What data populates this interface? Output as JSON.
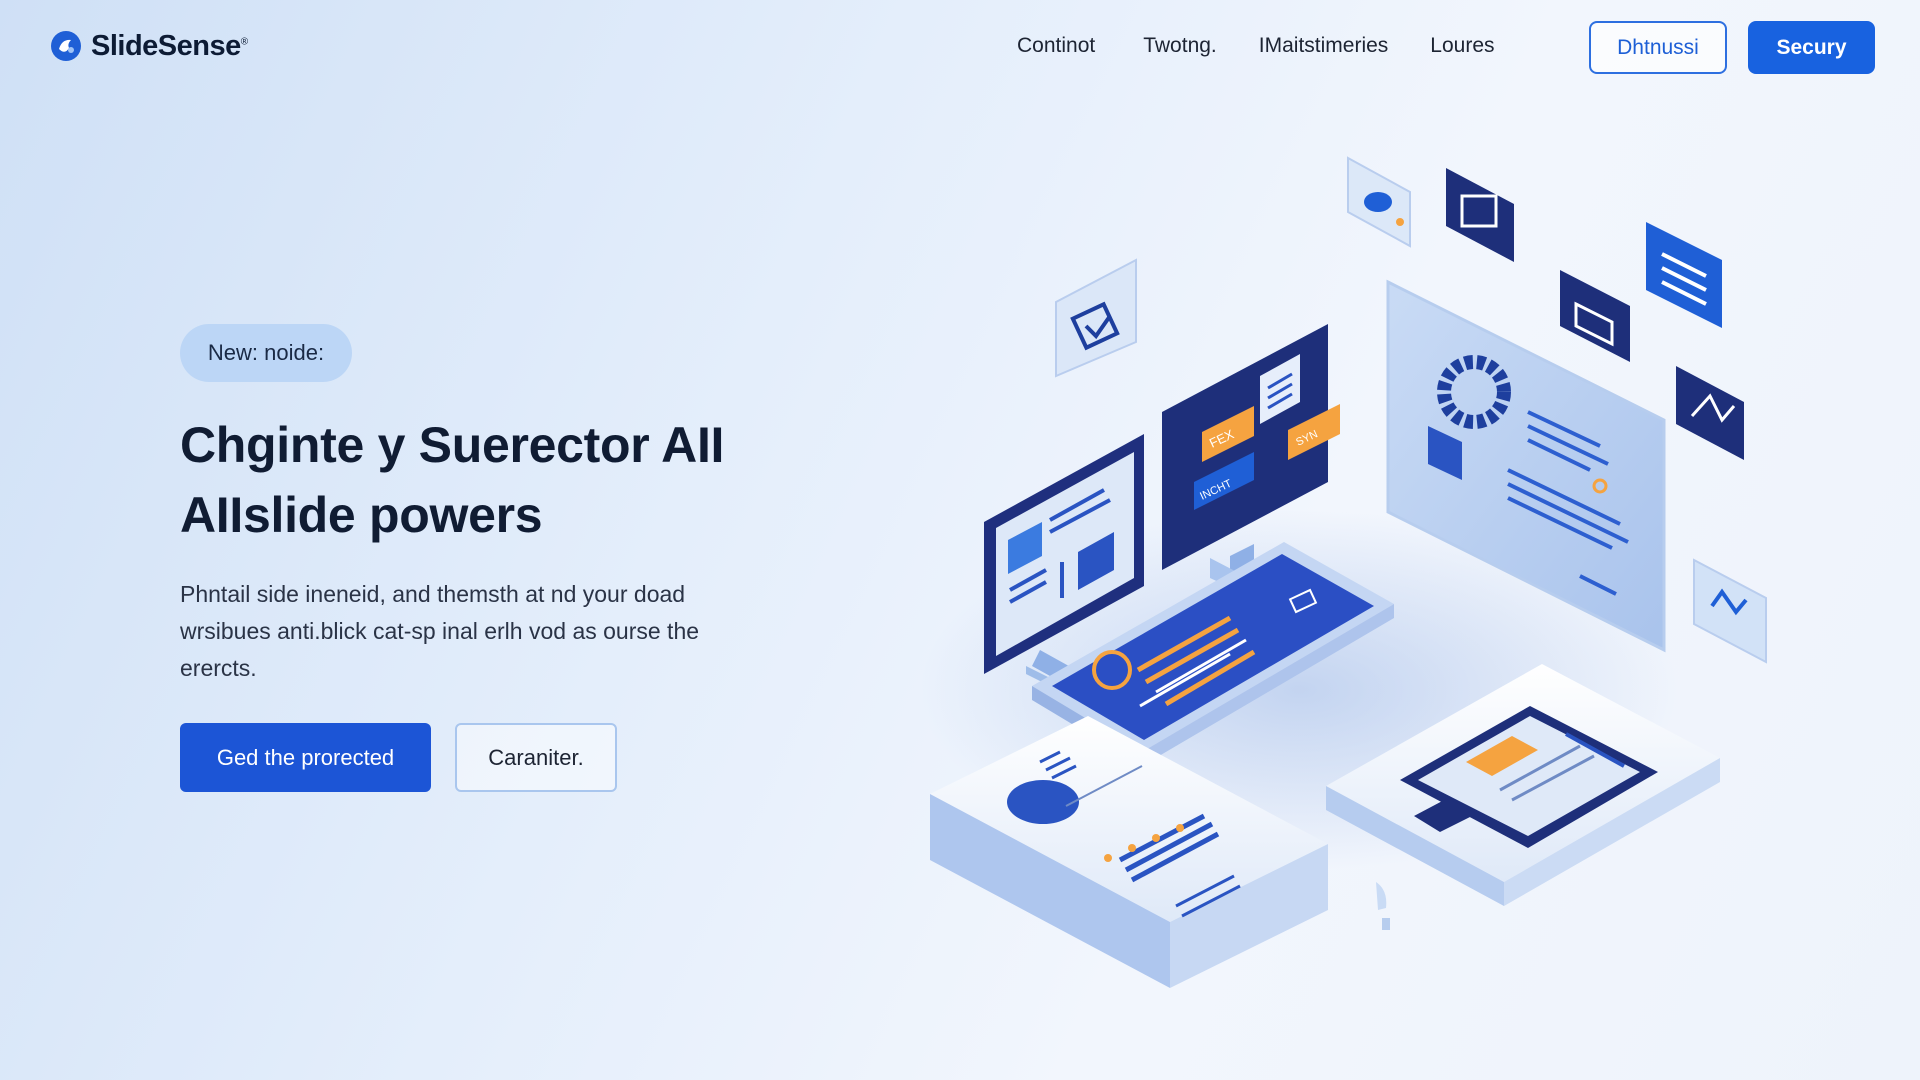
{
  "brand": {
    "name": "SlideSense",
    "reg": "®"
  },
  "nav": {
    "links": [
      "Continot",
      "Twotng.",
      "IMaitstimeries",
      "Loures"
    ],
    "outline_button": "Dhtnussi",
    "solid_button": "Secury"
  },
  "hero": {
    "badge": "New: noide:",
    "headline_line1": "Chginte y Suerector AII",
    "headline_line2": "AIIslide powers",
    "subtext": "Phntail side ineneid, and themsth at nd your doad wrsibues anti.blick cat-sp inal erlh vod as ourse the erercts.",
    "primary_button": "Ged the prorected",
    "secondary_button": "Caraniter."
  },
  "illustration": {
    "card_labels": {
      "tag_1": "FEX",
      "tag_2": "SYN",
      "tag_3": "INCHT"
    }
  },
  "colors": {
    "accent": "#1862e0",
    "navy": "#1e2f7a",
    "orange": "#f5a340",
    "light_blue": "#bcd6f6"
  }
}
